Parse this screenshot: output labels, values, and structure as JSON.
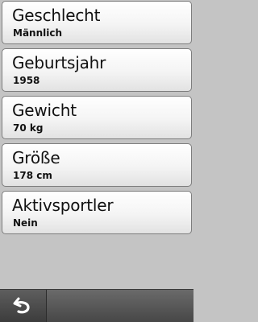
{
  "settings": {
    "items": [
      {
        "label": "Geschlecht",
        "value": "Männlich"
      },
      {
        "label": "Geburtsjahr",
        "value": "1958"
      },
      {
        "label": "Gewicht",
        "value": "70 kg"
      },
      {
        "label": "Größe",
        "value": "178 cm"
      },
      {
        "label": "Aktivsportler",
        "value": "Nein"
      }
    ]
  },
  "toolbar": {
    "back_icon": "back-arrow-icon"
  },
  "colors": {
    "background": "#c4c4c4",
    "item_border": "#7d7d7d",
    "toolbar": "#474747",
    "icon": "#ffffff"
  }
}
